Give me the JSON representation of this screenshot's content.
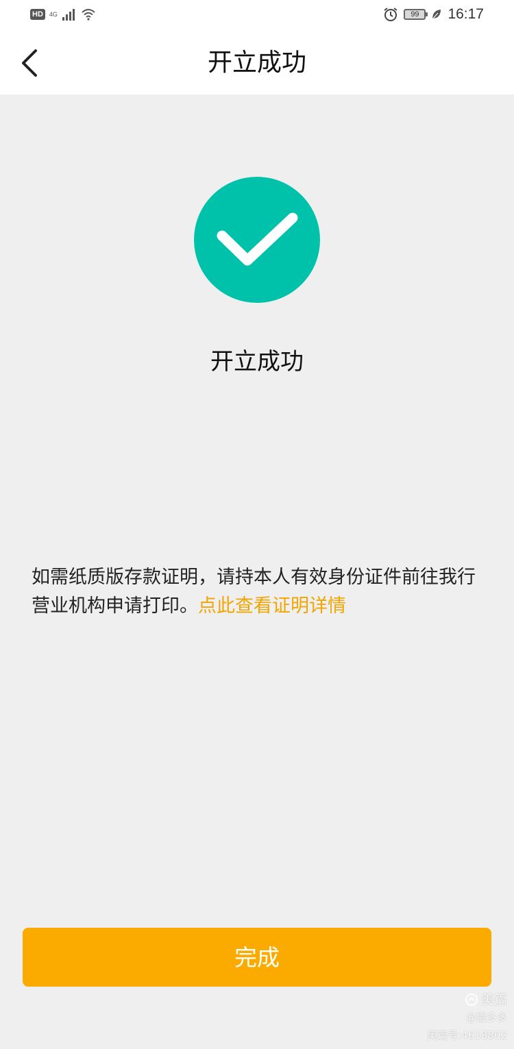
{
  "status_bar": {
    "hd": "HD",
    "network": "4G",
    "battery": "99",
    "time": "16:17"
  },
  "header": {
    "title": "开立成功"
  },
  "result": {
    "title": "开立成功",
    "icon": "check-circle-icon",
    "icon_color": "#00c2aa"
  },
  "note": {
    "text": "如需纸质版存款证明，请持本人有效身份证件前往我行营业机构申请打印。",
    "link": "点此查看证明详情",
    "link_color": "#f2a500"
  },
  "footer": {
    "done_label": "完成",
    "button_color": "#fbab00"
  },
  "watermark": {
    "brand": "美篇",
    "author": "@霞多多",
    "id": "美篇号:4618802"
  }
}
